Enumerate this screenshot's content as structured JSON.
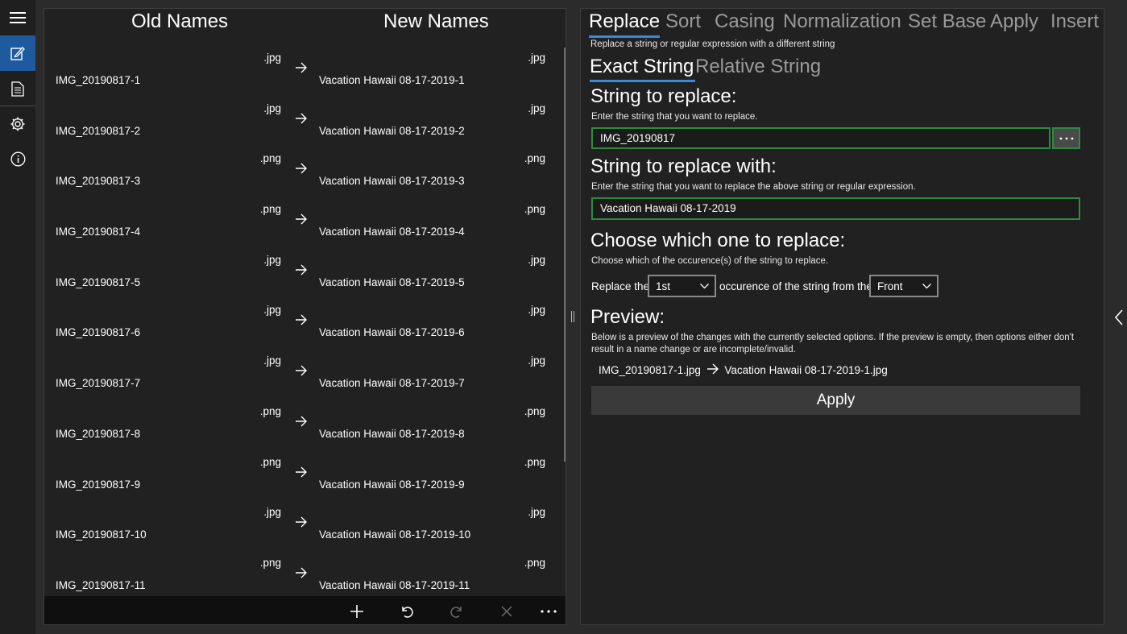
{
  "nav": {
    "items": [
      "hamburger-icon",
      "edit-icon",
      "document-icon",
      "gear-icon",
      "info-icon"
    ],
    "active": "edit-icon"
  },
  "left_panel": {
    "old_header": "Old Names",
    "new_header": "New Names",
    "rows": [
      {
        "old": "IMG_20190817-1",
        "old_ext": ".jpg",
        "new": "Vacation Hawaii 08-17-2019-1",
        "new_ext": ".jpg"
      },
      {
        "old": "IMG_20190817-2",
        "old_ext": ".jpg",
        "new": "Vacation Hawaii 08-17-2019-2",
        "new_ext": ".jpg"
      },
      {
        "old": "IMG_20190817-3",
        "old_ext": ".png",
        "new": "Vacation Hawaii 08-17-2019-3",
        "new_ext": ".png"
      },
      {
        "old": "IMG_20190817-4",
        "old_ext": ".png",
        "new": "Vacation Hawaii 08-17-2019-4",
        "new_ext": ".png"
      },
      {
        "old": "IMG_20190817-5",
        "old_ext": ".jpg",
        "new": "Vacation Hawaii 08-17-2019-5",
        "new_ext": ".jpg"
      },
      {
        "old": "IMG_20190817-6",
        "old_ext": ".jpg",
        "new": "Vacation Hawaii 08-17-2019-6",
        "new_ext": ".jpg"
      },
      {
        "old": "IMG_20190817-7",
        "old_ext": ".jpg",
        "new": "Vacation Hawaii 08-17-2019-7",
        "new_ext": ".jpg"
      },
      {
        "old": "IMG_20190817-8",
        "old_ext": ".png",
        "new": "Vacation Hawaii 08-17-2019-8",
        "new_ext": ".png"
      },
      {
        "old": "IMG_20190817-9",
        "old_ext": ".png",
        "new": "Vacation Hawaii 08-17-2019-9",
        "new_ext": ".png"
      },
      {
        "old": "IMG_20190817-10",
        "old_ext": ".jpg",
        "new": "Vacation Hawaii 08-17-2019-10",
        "new_ext": ".jpg"
      },
      {
        "old": "IMG_20190817-11",
        "old_ext": ".png",
        "new": "Vacation Hawaii 08-17-2019-11",
        "new_ext": ".png"
      }
    ],
    "commands": [
      "add-icon",
      "undo-icon",
      "redo-icon",
      "close-icon",
      "more-icon"
    ]
  },
  "right_panel": {
    "tabs": [
      "Replace",
      "Sort",
      "Casing",
      "Normalization",
      "Set Base",
      "Apply",
      "Insert"
    ],
    "active_tab": "Replace",
    "description": "Replace a string or regular expression with a different string",
    "subtabs": [
      "Exact String",
      "Relative String"
    ],
    "active_subtab": "Exact String",
    "find": {
      "title": "String to replace:",
      "hint": "Enter the string that you want to replace.",
      "value": "IMG_20190817"
    },
    "replace": {
      "title": "String to replace with:",
      "hint": "Enter the string that you want to replace the above string or regular expression.",
      "value": "Vacation Hawaii 08-17-2019"
    },
    "occurrence": {
      "title": "Choose which one to replace:",
      "hint": "Choose which of the occurence(s) of the string to replace.",
      "prefix": "Replace the",
      "which_value": "1st",
      "middle": "occurence of the string from the",
      "from_value": "Front"
    },
    "preview": {
      "title": "Preview:",
      "hint": "Below is a preview of the changes with the currently selected options. If the preview is empty, then options either don't result in a name change or are incomplete/invalid.",
      "old": "IMG_20190817-1.jpg",
      "new": "Vacation Hawaii 08-17-2019-1.jpg"
    },
    "apply_label": "Apply"
  },
  "colors": {
    "accent": "#3b8ad8",
    "nav_active": "#1f5a9e",
    "input_border": "#2d8a3f"
  }
}
